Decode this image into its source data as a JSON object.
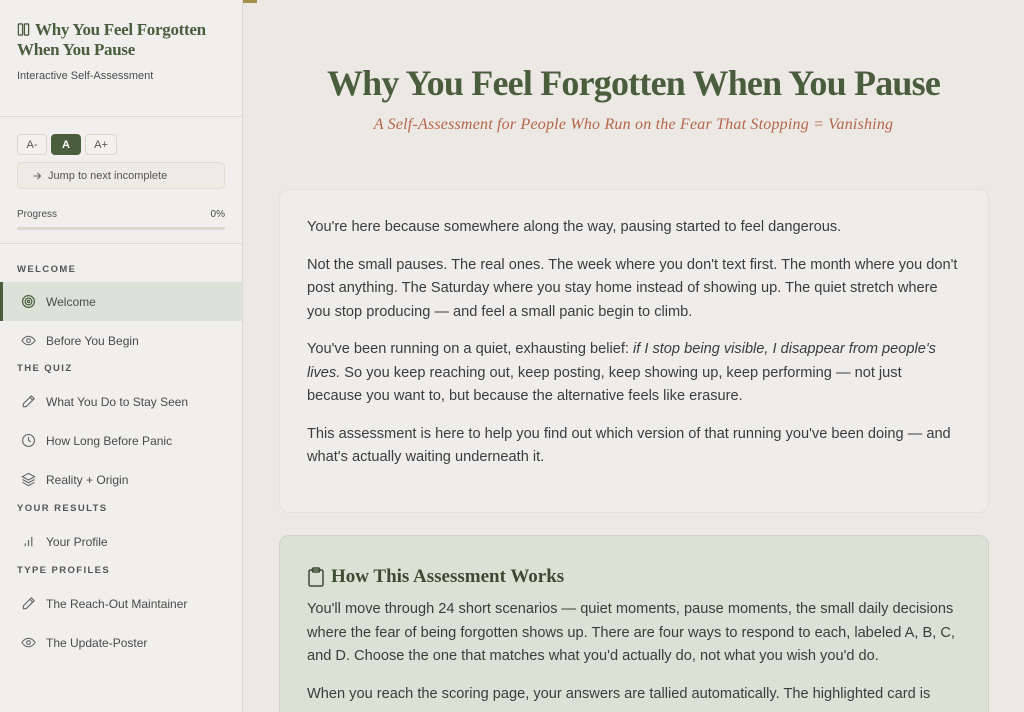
{
  "sidebar": {
    "brand_title": "Why You Feel Forgotten When You Pause",
    "brand_subtitle": "Interactive Self-Assessment",
    "font_buttons": [
      "A-",
      "A",
      "A+"
    ],
    "jump_label": "Jump to next incomplete",
    "progress_label": "Progress",
    "progress_value": "0%",
    "sections": [
      {
        "label": "WELCOME",
        "items": [
          {
            "label": "Welcome",
            "icon": "target-icon",
            "active": true
          },
          {
            "label": "Before You Begin",
            "icon": "eye-icon"
          }
        ]
      },
      {
        "label": "THE QUIZ",
        "items": [
          {
            "label": "What You Do to Stay Seen",
            "icon": "pencil-icon"
          },
          {
            "label": "How Long Before Panic",
            "icon": "clock-icon"
          },
          {
            "label": "Reality + Origin",
            "icon": "layers-icon"
          }
        ]
      },
      {
        "label": "YOUR RESULTS",
        "items": [
          {
            "label": "Your Profile",
            "icon": "bar-chart-icon"
          }
        ]
      },
      {
        "label": "TYPE PROFILES",
        "items": [
          {
            "label": "The Reach-Out Maintainer",
            "icon": "pencil-icon"
          },
          {
            "label": "The Update-Poster",
            "icon": "eye-icon"
          }
        ]
      }
    ]
  },
  "main": {
    "title": "Why You Feel Forgotten When You Pause",
    "subtitle": "A Self-Assessment for People Who Run on the Fear That Stopping = Vanishing",
    "intro": {
      "p1": "You're here because somewhere along the way, pausing started to feel dangerous.",
      "p2": "Not the small pauses. The real ones. The week where you don't text first. The month where you don't post anything. The Saturday where you stay home instead of showing up. The quiet stretch where you stop producing — and feel a small panic begin to climb.",
      "p3_a": "You've been running on a quiet, exhausting belief: ",
      "p3_em": "if I stop being visible, I disappear from people's lives.",
      "p3_b": " So you keep reaching out, keep posting, keep showing up, keep performing — not just because you want to, but because the alternative feels like erasure.",
      "p4": "This assessment is here to help you find out which version of that running you've been doing — and what's actually waiting underneath it."
    },
    "how": {
      "heading": "How This Assessment Works",
      "p1": "You'll move through 24 short scenarios — quiet moments, pause moments, the small daily decisions where the fear of being forgotten shows up. There are four ways to respond to each, labeled A, B, C, and D. Choose the one that matches what you'd actually do, not what you wish you'd do.",
      "p2": "When you reach the scoring page, your answers are tallied automatically. The highlighted card is your"
    }
  },
  "colors": {
    "accent": "#4a5e3e",
    "subtitle": "#b5654a",
    "gold": "#a58f4a"
  },
  "progress_fraction": 0
}
